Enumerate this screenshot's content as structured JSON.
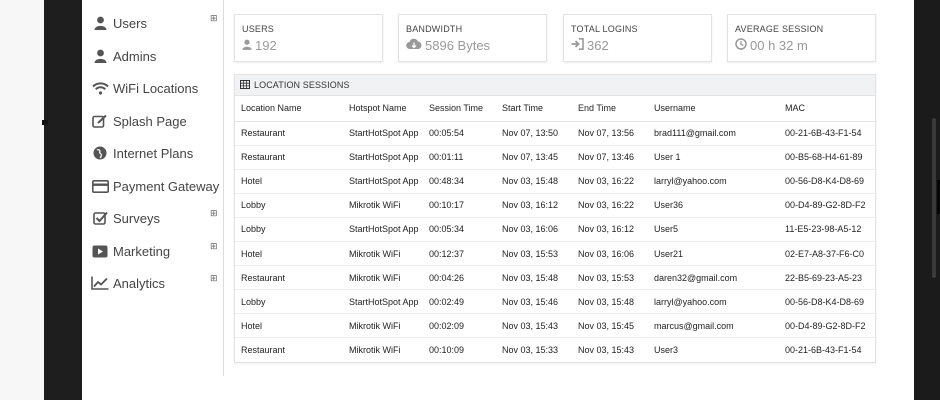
{
  "sidebar": {
    "items": [
      {
        "label": "Users",
        "icon": "user-icon",
        "expandable": true
      },
      {
        "label": "Admins",
        "icon": "admin-user-icon",
        "expandable": false
      },
      {
        "label": "WiFi Locations",
        "icon": "wifi-icon",
        "expandable": false
      },
      {
        "label": "Splash Page",
        "icon": "edit-icon",
        "expandable": false
      },
      {
        "label": "Internet Plans",
        "icon": "globe-icon",
        "expandable": false
      },
      {
        "label": "Payment Gateway",
        "icon": "credit-card-icon",
        "expandable": false
      },
      {
        "label": "Surveys",
        "icon": "checkbox-icon",
        "expandable": true
      },
      {
        "label": "Marketing",
        "icon": "play-icon",
        "expandable": true
      },
      {
        "label": "Analytics",
        "icon": "line-chart-icon",
        "expandable": true
      }
    ],
    "expand_glyph": "⊞"
  },
  "stats": [
    {
      "title": "USERS",
      "value": "192",
      "icon": "user-icon"
    },
    {
      "title": "BANDWIDTH",
      "value": "5896 Bytes",
      "icon": "cloud-download-icon"
    },
    {
      "title": "TOTAL LOGINS",
      "value": "362",
      "icon": "sign-in-icon"
    },
    {
      "title": "AVERAGE SESSION",
      "value": "00 h 32 m",
      "icon": "clock-icon"
    }
  ],
  "sessions": {
    "title": "LOCATION SESSIONS",
    "columns": [
      "Location Name",
      "Hotspot Name",
      "Session Time",
      "Start Time",
      "End Time",
      "Username",
      "MAC"
    ],
    "rows": [
      [
        "Restaurant",
        "StartHotSpot App",
        "00:05:54",
        "Nov 07, 13:50",
        "Nov 07, 13:56",
        "brad111@gmail.com",
        "00-21-6B-43-F1-54"
      ],
      [
        "Restaurant",
        "StartHotSpot App",
        "00:01:11",
        "Nov 07, 13:45",
        "Nov 07, 13:46",
        "User 1",
        "00-B5-68-H4-61-89"
      ],
      [
        "Hotel",
        "StartHotSpot App",
        "00:48:34",
        "Nov 03, 15:48",
        "Nov 03, 16:22",
        "larryl@yahoo.com",
        "00-56-D8-K4-D8-69"
      ],
      [
        "Lobby",
        "Mikrotik WiFi",
        "00:10:17",
        "Nov 03, 16:12",
        "Nov 03, 16:22",
        "User36",
        "00-D4-89-G2-8D-F2"
      ],
      [
        "Lobby",
        "StartHotSpot App",
        "00:05:34",
        "Nov 03, 16:06",
        "Nov 03, 16:12",
        "User5",
        "11-E5-23-98-A5-12"
      ],
      [
        "Hotel",
        "Mikrotik WiFi",
        "00:12:37",
        "Nov 03, 15:53",
        "Nov 03, 16:06",
        "User21",
        "02-E7-A8-37-F6-C0"
      ],
      [
        "Restaurant",
        "Mikrotik WiFi",
        "00:04:26",
        "Nov 03, 15:48",
        "Nov 03, 15:53",
        "daren32@gmail.com",
        "22-B5-69-23-A5-23"
      ],
      [
        "Lobby",
        "StartHotSpot App",
        "00:02:49",
        "Nov 03, 15:46",
        "Nov 03, 15:48",
        "larryl@yahoo.com",
        "00-56-D8-K4-D8-69"
      ],
      [
        "Hotel",
        "Mikrotik WiFi",
        "00:02:09",
        "Nov 03, 15:43",
        "Nov 03, 15:45",
        "marcus@gmail.com",
        "00-D4-89-G2-8D-F2"
      ],
      [
        "Restaurant",
        "Mikrotik WiFi",
        "00:10:09",
        "Nov 03, 15:33",
        "Nov 03, 15:43",
        "User3",
        "00-21-6B-43-F1-54"
      ]
    ]
  }
}
